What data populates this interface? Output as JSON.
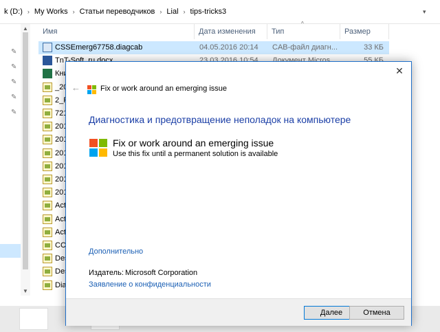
{
  "explorer": {
    "breadcrumb": [
      "k (D:)",
      "My Works",
      "Статьи переводчиков",
      "Lial",
      "tips-tricks3"
    ],
    "columns": {
      "name": "Имя",
      "date": "Дата изменения",
      "type": "Тип",
      "size": "Размер"
    },
    "files": [
      {
        "name": "CSSEmerg67758.diagcab",
        "date": "04.05.2016 20:14",
        "type": "CAB-файл диагн...",
        "size": "33 КБ",
        "icon": "cab-file-icon",
        "selected": true
      },
      {
        "name": "TnT-Soft_ru.docx",
        "date": "23.03.2016 10:54",
        "type": "Документ Micros...",
        "size": "55 КБ",
        "icon": "word-file-icon",
        "selected": false
      },
      {
        "name": "Кни",
        "date": "",
        "type": "",
        "size": "",
        "icon": "excel-file-icon",
        "selected": false
      },
      {
        "name": "_20",
        "date": "",
        "type": "",
        "size": "",
        "icon": "image-file-icon",
        "selected": false
      },
      {
        "name": "2_P",
        "date": "",
        "type": "",
        "size": "",
        "icon": "image-file-icon",
        "selected": false
      },
      {
        "name": "721",
        "date": "",
        "type": "",
        "size": "",
        "icon": "image-file-icon",
        "selected": false
      },
      {
        "name": "201",
        "date": "",
        "type": "",
        "size": "",
        "icon": "image-file-icon",
        "selected": false
      },
      {
        "name": "201",
        "date": "",
        "type": "",
        "size": "",
        "icon": "image-file-icon",
        "selected": false
      },
      {
        "name": "201",
        "date": "",
        "type": "",
        "size": "",
        "icon": "image-file-icon",
        "selected": false
      },
      {
        "name": "201",
        "date": "",
        "type": "",
        "size": "",
        "icon": "image-file-icon",
        "selected": false
      },
      {
        "name": "201",
        "date": "",
        "type": "",
        "size": "",
        "icon": "image-file-icon",
        "selected": false
      },
      {
        "name": "201",
        "date": "",
        "type": "",
        "size": "",
        "icon": "image-file-icon",
        "selected": false
      },
      {
        "name": "Act",
        "date": "",
        "type": "",
        "size": "",
        "icon": "image-file-icon",
        "selected": false
      },
      {
        "name": "Act",
        "date": "",
        "type": "",
        "size": "",
        "icon": "image-file-icon",
        "selected": false
      },
      {
        "name": "Act",
        "date": "",
        "type": "",
        "size": "",
        "icon": "image-file-icon",
        "selected": false
      },
      {
        "name": "CC",
        "date": "",
        "type": "",
        "size": "",
        "icon": "image-file-icon",
        "selected": false
      },
      {
        "name": "Des",
        "date": "",
        "type": "",
        "size": "",
        "icon": "image-file-icon",
        "selected": false
      },
      {
        "name": "Des",
        "date": "",
        "type": "",
        "size": "",
        "icon": "image-file-icon",
        "selected": false
      },
      {
        "name": "Dia",
        "date": "",
        "type": "",
        "size": "",
        "icon": "image-file-icon",
        "selected": false
      }
    ]
  },
  "dialog": {
    "window_title": "Fix or work around an emerging issue",
    "heading": "Диагностика и предотвращение неполадок на компьютере",
    "option_title": "Fix or work around an emerging issue",
    "option_description": "Use this fix until a permanent solution is available",
    "advanced_link": "Дополнительно",
    "publisher_label": "Издатель:",
    "publisher_value": "Microsoft Corporation",
    "privacy_link": "Заявление о конфиденциальности",
    "next_button": "Далее",
    "cancel_button": "Отмена",
    "close_glyph": "✕",
    "back_glyph": "←",
    "colors": {
      "accent": "#1e6fc9",
      "heading": "#1a3ea6",
      "link": "#1a5fb4",
      "selection": "#cce8ff"
    }
  }
}
